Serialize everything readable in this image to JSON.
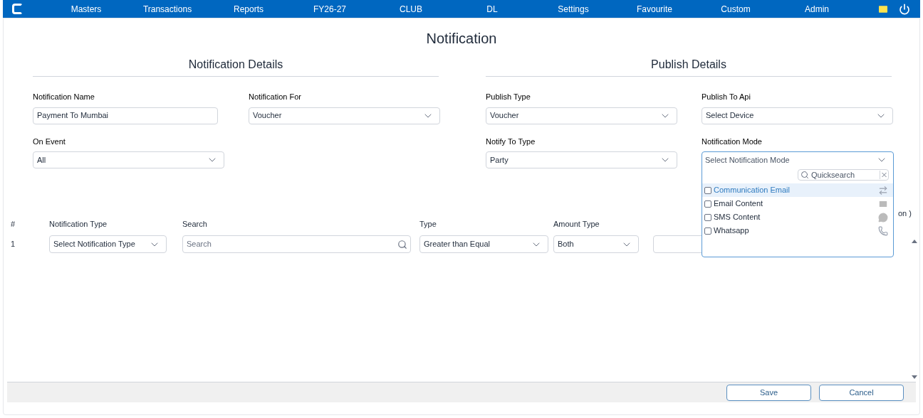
{
  "nav": {
    "items": [
      "Masters",
      "Transactions",
      "Reports",
      "FY26-27",
      "CLUB",
      "DL",
      "Settings",
      "Favourite",
      "Custom",
      "Admin"
    ]
  },
  "title": "Notification",
  "sections": [
    {
      "heading": "Notification Details",
      "fields": [
        {
          "label": "Notification Name",
          "kind": "text",
          "value": "Payment To Mumbai"
        },
        {
          "label": "Notification For",
          "kind": "select",
          "value": "Voucher"
        },
        {
          "label": "On Event",
          "kind": "select",
          "value": "All"
        }
      ]
    },
    {
      "heading": "Publish Details",
      "fields": [
        {
          "label": "Publish Type",
          "kind": "select",
          "value": "Voucher"
        },
        {
          "label": "Publish To Api",
          "kind": "select",
          "value": "Select Device"
        },
        {
          "label": "Notify To Type",
          "kind": "select",
          "value": "Party"
        },
        {
          "label": "Notification Mode",
          "kind": "multiselect",
          "placeholder": "Select Notification Mode",
          "expanded": true,
          "search_placeholder": "Quicksearch",
          "options": [
            {
              "label": "Communication Email",
              "kind": "exchange",
              "checked": false,
              "highlighted": true
            },
            {
              "label": "Email Content",
              "kind": "email",
              "checked": false,
              "highlighted": false
            },
            {
              "label": "SMS Content",
              "kind": "sms",
              "checked": false,
              "highlighted": false
            },
            {
              "label": "Whatsapp",
              "kind": "whatsapp",
              "checked": false,
              "highlighted": false
            }
          ]
        }
      ]
    }
  ],
  "table": {
    "columns": [
      "#",
      "Notification Type",
      "Search",
      "Type",
      "Amount Type",
      "on )"
    ],
    "rows": [
      {
        "number": "1",
        "notification_type": "Select Notification Type",
        "search_placeholder": "Search",
        "type": "Greater than Equal",
        "amount_type": "Both"
      }
    ]
  },
  "buttons": [
    "Save",
    "Cancel"
  ]
}
